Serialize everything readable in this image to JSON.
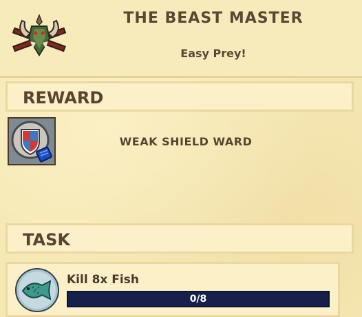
{
  "quest": {
    "title": "THE BEAST MASTER",
    "subtitle": "Easy Prey!",
    "icon": "horned-beast-crossbow-icon"
  },
  "reward": {
    "section_title": "REWARD",
    "item_name": "WEAK SHIELD WARD",
    "item_icon": "shield-ward-icon"
  },
  "task": {
    "section_title": "TASK",
    "label": "Kill 8x Fish",
    "icon": "fish-icon",
    "progress_text": "0/8",
    "progress_fraction": 0
  },
  "colors": {
    "parchment": "#f6e8b4",
    "text": "#5a4431",
    "progress_track": "#16204a"
  }
}
